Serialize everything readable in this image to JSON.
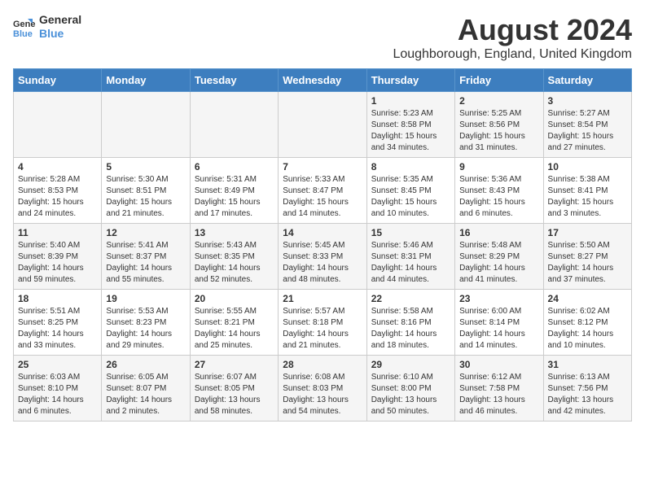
{
  "header": {
    "logo_line1": "General",
    "logo_line2": "Blue",
    "month_year": "August 2024",
    "location": "Loughborough, England, United Kingdom"
  },
  "days_of_week": [
    "Sunday",
    "Monday",
    "Tuesday",
    "Wednesday",
    "Thursday",
    "Friday",
    "Saturday"
  ],
  "weeks": [
    [
      {
        "day": "",
        "info": ""
      },
      {
        "day": "",
        "info": ""
      },
      {
        "day": "",
        "info": ""
      },
      {
        "day": "",
        "info": ""
      },
      {
        "day": "1",
        "info": "Sunrise: 5:23 AM\nSunset: 8:58 PM\nDaylight: 15 hours\nand 34 minutes."
      },
      {
        "day": "2",
        "info": "Sunrise: 5:25 AM\nSunset: 8:56 PM\nDaylight: 15 hours\nand 31 minutes."
      },
      {
        "day": "3",
        "info": "Sunrise: 5:27 AM\nSunset: 8:54 PM\nDaylight: 15 hours\nand 27 minutes."
      }
    ],
    [
      {
        "day": "4",
        "info": "Sunrise: 5:28 AM\nSunset: 8:53 PM\nDaylight: 15 hours\nand 24 minutes."
      },
      {
        "day": "5",
        "info": "Sunrise: 5:30 AM\nSunset: 8:51 PM\nDaylight: 15 hours\nand 21 minutes."
      },
      {
        "day": "6",
        "info": "Sunrise: 5:31 AM\nSunset: 8:49 PM\nDaylight: 15 hours\nand 17 minutes."
      },
      {
        "day": "7",
        "info": "Sunrise: 5:33 AM\nSunset: 8:47 PM\nDaylight: 15 hours\nand 14 minutes."
      },
      {
        "day": "8",
        "info": "Sunrise: 5:35 AM\nSunset: 8:45 PM\nDaylight: 15 hours\nand 10 minutes."
      },
      {
        "day": "9",
        "info": "Sunrise: 5:36 AM\nSunset: 8:43 PM\nDaylight: 15 hours\nand 6 minutes."
      },
      {
        "day": "10",
        "info": "Sunrise: 5:38 AM\nSunset: 8:41 PM\nDaylight: 15 hours\nand 3 minutes."
      }
    ],
    [
      {
        "day": "11",
        "info": "Sunrise: 5:40 AM\nSunset: 8:39 PM\nDaylight: 14 hours\nand 59 minutes."
      },
      {
        "day": "12",
        "info": "Sunrise: 5:41 AM\nSunset: 8:37 PM\nDaylight: 14 hours\nand 55 minutes."
      },
      {
        "day": "13",
        "info": "Sunrise: 5:43 AM\nSunset: 8:35 PM\nDaylight: 14 hours\nand 52 minutes."
      },
      {
        "day": "14",
        "info": "Sunrise: 5:45 AM\nSunset: 8:33 PM\nDaylight: 14 hours\nand 48 minutes."
      },
      {
        "day": "15",
        "info": "Sunrise: 5:46 AM\nSunset: 8:31 PM\nDaylight: 14 hours\nand 44 minutes."
      },
      {
        "day": "16",
        "info": "Sunrise: 5:48 AM\nSunset: 8:29 PM\nDaylight: 14 hours\nand 41 minutes."
      },
      {
        "day": "17",
        "info": "Sunrise: 5:50 AM\nSunset: 8:27 PM\nDaylight: 14 hours\nand 37 minutes."
      }
    ],
    [
      {
        "day": "18",
        "info": "Sunrise: 5:51 AM\nSunset: 8:25 PM\nDaylight: 14 hours\nand 33 minutes."
      },
      {
        "day": "19",
        "info": "Sunrise: 5:53 AM\nSunset: 8:23 PM\nDaylight: 14 hours\nand 29 minutes."
      },
      {
        "day": "20",
        "info": "Sunrise: 5:55 AM\nSunset: 8:21 PM\nDaylight: 14 hours\nand 25 minutes."
      },
      {
        "day": "21",
        "info": "Sunrise: 5:57 AM\nSunset: 8:18 PM\nDaylight: 14 hours\nand 21 minutes."
      },
      {
        "day": "22",
        "info": "Sunrise: 5:58 AM\nSunset: 8:16 PM\nDaylight: 14 hours\nand 18 minutes."
      },
      {
        "day": "23",
        "info": "Sunrise: 6:00 AM\nSunset: 8:14 PM\nDaylight: 14 hours\nand 14 minutes."
      },
      {
        "day": "24",
        "info": "Sunrise: 6:02 AM\nSunset: 8:12 PM\nDaylight: 14 hours\nand 10 minutes."
      }
    ],
    [
      {
        "day": "25",
        "info": "Sunrise: 6:03 AM\nSunset: 8:10 PM\nDaylight: 14 hours\nand 6 minutes."
      },
      {
        "day": "26",
        "info": "Sunrise: 6:05 AM\nSunset: 8:07 PM\nDaylight: 14 hours\nand 2 minutes."
      },
      {
        "day": "27",
        "info": "Sunrise: 6:07 AM\nSunset: 8:05 PM\nDaylight: 13 hours\nand 58 minutes."
      },
      {
        "day": "28",
        "info": "Sunrise: 6:08 AM\nSunset: 8:03 PM\nDaylight: 13 hours\nand 54 minutes."
      },
      {
        "day": "29",
        "info": "Sunrise: 6:10 AM\nSunset: 8:00 PM\nDaylight: 13 hours\nand 50 minutes."
      },
      {
        "day": "30",
        "info": "Sunrise: 6:12 AM\nSunset: 7:58 PM\nDaylight: 13 hours\nand 46 minutes."
      },
      {
        "day": "31",
        "info": "Sunrise: 6:13 AM\nSunset: 7:56 PM\nDaylight: 13 hours\nand 42 minutes."
      }
    ]
  ]
}
